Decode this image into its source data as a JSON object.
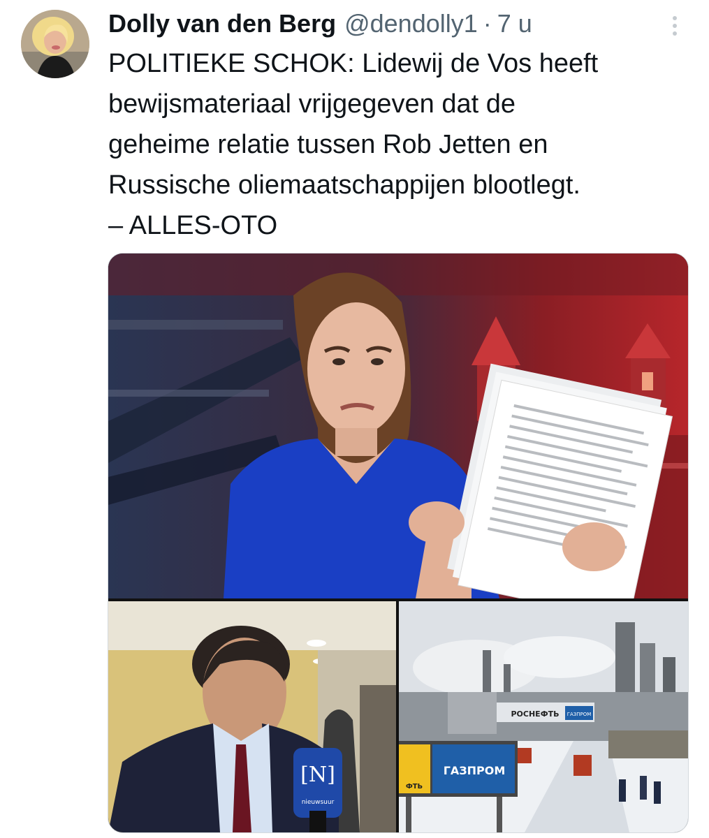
{
  "tweet": {
    "author_name": "Dolly van den Berg",
    "handle": "@dendolly1",
    "separator": "·",
    "time": "7 u",
    "text": "POLITIEKE SCHOK: Lidewij de Vos heeft\nbewijsmateriaal vrijgegeven dat de\ngeheime relatie tussen Rob Jetten en\nRussische oliemaatschappijen blootlegt.\n– ALLES-OTO"
  },
  "media": {
    "image2": {
      "mic_logo": "[N]",
      "mic_text": "nieuwsuur"
    },
    "image3": {
      "sign_rosneft": "РОСНЕФТЬ",
      "sign_gazprom_small": "ГАЗПРОМ",
      "billboard_gazprom": "ГАЗПРОМ",
      "billboard_fragment": "ФТЬ"
    }
  },
  "icons": {
    "more": "vertical-ellipsis-icon"
  },
  "colors": {
    "text_primary": "#0f1419",
    "text_secondary": "#536471",
    "gazprom_blue": "#1f5fa8",
    "dress_blue": "#1a3fc4"
  }
}
